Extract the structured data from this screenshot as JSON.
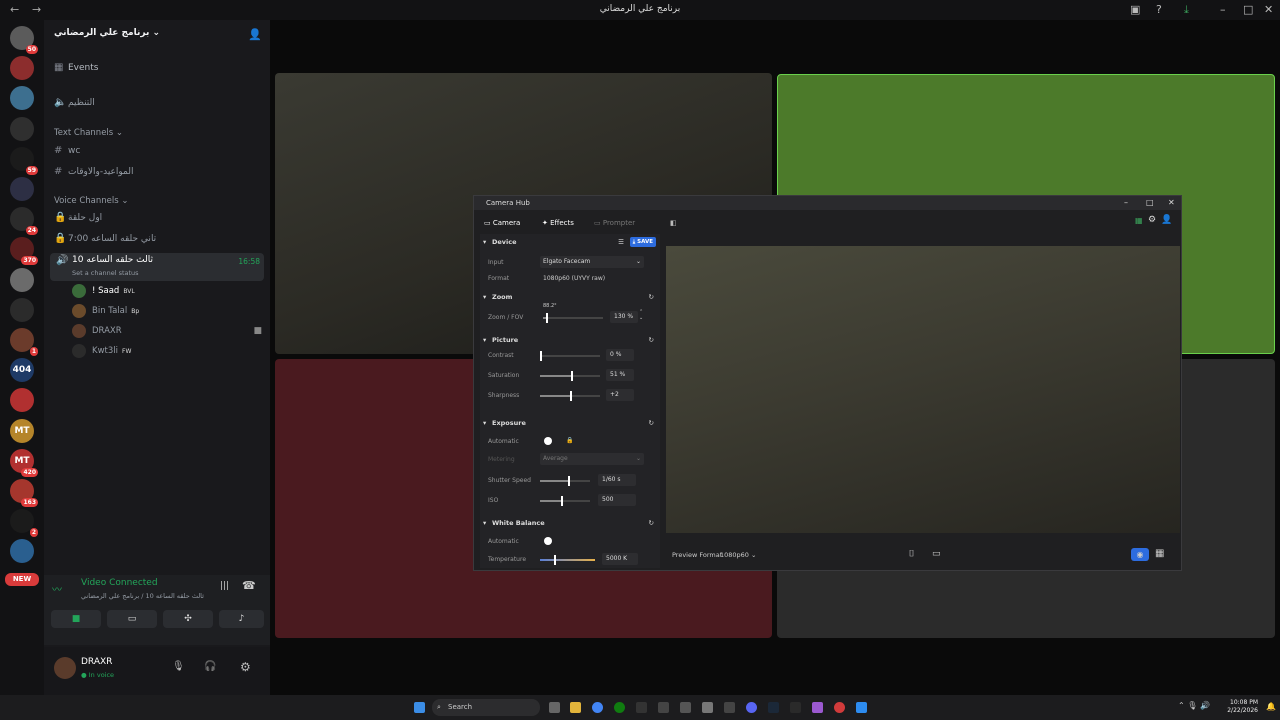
{
  "window": {
    "title": "برنامج علي الرمضاني"
  },
  "servers": [
    {
      "name": "srv-1",
      "badge": "50",
      "color": "#5b5b5b"
    },
    {
      "name": "srv-2",
      "badge": "",
      "color": "#8c2d2d"
    },
    {
      "name": "srv-3",
      "badge": "",
      "color": "#3d6f8f"
    },
    {
      "name": "srv-4",
      "badge": "",
      "color": "#2f2f2f"
    },
    {
      "name": "srv-5",
      "badge": "59",
      "color": "#1b1b1b"
    },
    {
      "name": "srv-6",
      "badge": "",
      "color": "#2d2f44"
    },
    {
      "name": "srv-7",
      "badge": "24",
      "color": "#2b2b2b"
    },
    {
      "name": "srv-8",
      "badge": "370",
      "color": "#5a1e1e"
    },
    {
      "name": "srv-9",
      "badge": "",
      "color": "#6b6b6b"
    },
    {
      "name": "srv-10",
      "badge": "",
      "color": "#2b2b2b"
    },
    {
      "name": "srv-11",
      "badge": "1",
      "color": "#6b3b2b"
    },
    {
      "name": "404",
      "badge": "",
      "color": "#1e3a66"
    },
    {
      "name": "srv-13",
      "badge": "",
      "color": "#b13030"
    },
    {
      "name": "MT",
      "badge": "",
      "color": "#b5852a"
    },
    {
      "name": "MT",
      "badge": "420",
      "color": "#b13030"
    },
    {
      "name": "srv-16",
      "badge": "163",
      "color": "#a5362d"
    },
    {
      "name": "srv-17",
      "badge": "2",
      "color": "#1b1b1b"
    },
    {
      "name": "srv-18",
      "badge": "",
      "color": "#2a5f8f"
    }
  ],
  "new_label": "NEW",
  "sidebar": {
    "server_name": "برنامج علي الرمضاني",
    "events": "Events",
    "organize": "التنظيم",
    "text_category": "Text Channels",
    "text_channels": [
      "wc",
      "المواعيد-والاوقات"
    ],
    "voice_category": "Voice Channels",
    "voice_channels": [
      "اول حلقة",
      "تاني حلقه الساعه 7:00"
    ],
    "active_channel": "ثالث حلقه الساعه 10",
    "active_status": "Set a channel status",
    "active_timer": "16:58",
    "voice_users": [
      {
        "name": "! Saad",
        "tag": "BVL",
        "color": "#3a6b3a",
        "name_color": "#ffffff"
      },
      {
        "name": "Bin Talal",
        "tag": "Bp",
        "color": "#6b4b2b",
        "name_color": "#949ba4"
      },
      {
        "name": "DRAXR",
        "tag": "",
        "color": "#5a3b2b",
        "name_color": "#949ba4"
      },
      {
        "name": "Kwt3li",
        "tag": "FW",
        "color": "#2b2b2b",
        "name_color": "#949ba4"
      }
    ]
  },
  "voice_panel": {
    "status": "Video Connected",
    "channel": "ثالث حلقه الساعه 10 / برنامج علي الرمضاني"
  },
  "user_panel": {
    "name": "DRAXR",
    "status": "In voice"
  },
  "camera_hub": {
    "title": "Camera Hub",
    "tabs": [
      "Camera",
      "Effects",
      "Prompter"
    ],
    "save": "SAVE",
    "device": {
      "header": "Device",
      "input_label": "Input",
      "input_value": "Elgato Facecam",
      "format_label": "Format",
      "format_value": "1080p60 (UYVY raw)"
    },
    "zoom": {
      "header": "Zoom",
      "label": "Zoom / FOV",
      "value": "130 %",
      "fov": "88.2°",
      "level": 0.05
    },
    "picture": {
      "header": "Picture",
      "rows": [
        {
          "label": "Contrast",
          "value": "0 %",
          "level": 0.0
        },
        {
          "label": "Saturation",
          "value": "51 %",
          "level": 0.51
        },
        {
          "label": "Sharpness",
          "value": "+2",
          "level": 0.5
        }
      ]
    },
    "exposure": {
      "header": "Exposure",
      "auto_label": "Automatic",
      "metering_label": "Metering",
      "metering_value": "Average",
      "shutter_label": "Shutter Speed",
      "shutter_value": "1/60 s",
      "shutter_level": 0.55,
      "iso_label": "ISO",
      "iso_value": "500",
      "iso_level": 0.42
    },
    "white_balance": {
      "header": "White Balance",
      "auto_label": "Automatic",
      "temp_label": "Temperature",
      "temp_value": "5000 K",
      "temp_level": 0.25
    },
    "preview_format_label": "Preview Format",
    "preview_format_value": "1080p60"
  },
  "taskbar": {
    "search": "Search",
    "time": "10:08 PM",
    "date": "2/22/2026"
  },
  "colors": {
    "green_tile": "#4c7a2a",
    "red_tile": "#4a1a1f",
    "accent": "#2d6cdf",
    "voice_green": "#23a55a"
  }
}
